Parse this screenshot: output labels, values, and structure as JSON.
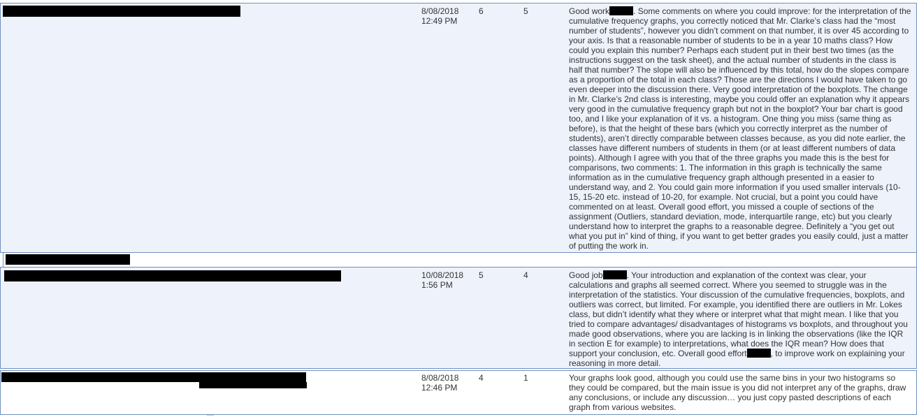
{
  "rows": [
    {
      "date": "8/08/2018",
      "time": "12:49 PM",
      "score1": "6",
      "score2": "5",
      "feedback_a": "Good work",
      "feedback_b": ". Some comments on where you could improve: for the interpretation of the cumulative frequency graphs, you correctly noticed that Mr. Clarke’s class had the “most number of students”, however you didn’t comment on that number, it is over 45 according to your axis. Is that a reasonable number of students to be in a year 10 maths class? How could you explain this number? Perhaps each student put in their best two times (as the instructions suggest on the task sheet), and the actual number of students in the class is half that number? The slope will also be influenced by this total, how do the slopes compare as a proportion of the total in each class? Those are the directions I would have taken to go even deeper into the discussion there. Very good interpretation of the boxplots. The change in Mr. Clarke’s 2nd class is interesting, maybe you could offer an explanation why it appears very good in the cumulative frequency graph but not in the boxplot? Your bar chart is good too, and I like your explanation of it vs. a histogram. One thing you miss (same thing as before), is that the height of these bars (which you correctly interpret as the number of students), aren’t directly comparable between classes because, as you did note earlier, the classes have different numbers of students in them (or at least different numbers of data points). Although I agree with you that of the three graphs you made this is the best for comparisons, two comments: 1. The information in this graph is technically the same information as in the cumulative frequency graph although presented in a easier to understand way, and 2. You could gain more information if you used smaller intervals (10-15, 15-20 etc. instead of 10-20, for example. Not crucial, but a point you could have commented on at least. Overall good effort, you missed a couple of sections of the assignment (Outliers, standard deviation, mode, interquartile range, etc) but you clearly understand how to interpret the graphs to a reasonable degree. Definitely a “you get out what you put in” kind of thing, if you want to get better grades you easily could, just a matter of putting the work in."
    },
    {
      "date": "10/08/2018",
      "time": "1:56 PM",
      "score1": "5",
      "score2": "4",
      "feedback_a": "Good job",
      "feedback_b": ". Your introduction and explanation of the context was clear, your calculations and graphs all seemed correct. Where you seemed to struggle was in the interpretation of the statistics. Your discussion of the cumulative frequencies, boxplots, and outliers was correct, but limited. For example, you identified there are outliers in Mr. Lokes class, but didn’t identify what they where or interpret what that might mean. I like that you tried to compare advantages/ disadvantages of histograms vs boxplots, and throughout you made good observations, where you are lacking is in linking the observations (like the IQR in section E for example) to interpretations, what does the IQR mean? How does that support your conclusion, etc. Overall good effort",
      "feedback_c": ", to improve work on explaining your reasoning in more detail."
    },
    {
      "date": "8/08/2018",
      "time": "12:46 PM",
      "score1": "4",
      "score2": "1",
      "feedback_a": "Your graphs look good, although you could use the same bins in your two histograms so they could be compared, but the main issue is you did not interpret any of the graphs, draw any conclusions, or include any discussion… you just copy pasted descriptions of each graph from various websites."
    }
  ]
}
